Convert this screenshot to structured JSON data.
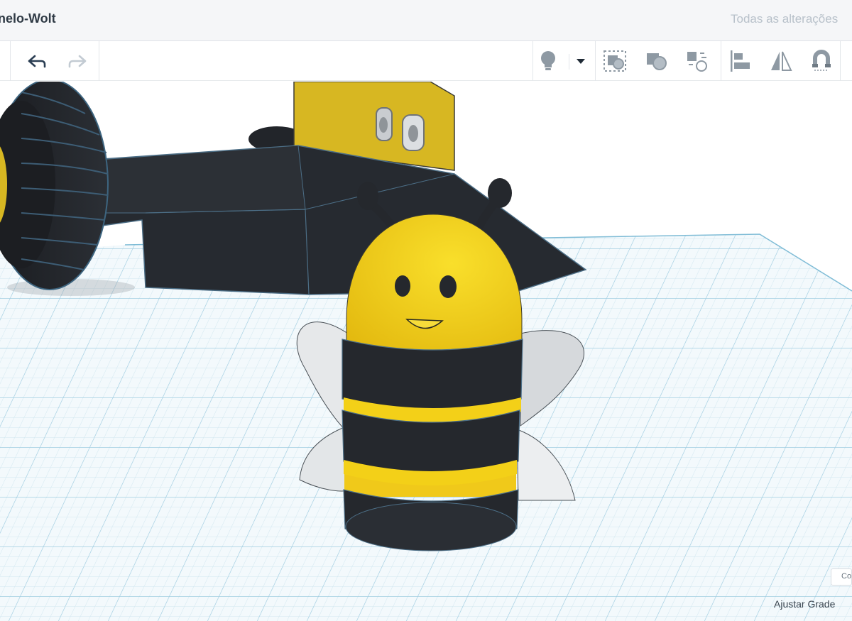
{
  "header": {
    "project_name": "nelo-Wolt",
    "save_status": "Todas as alterações"
  },
  "toolbar": {
    "left": [
      {
        "icon": "undo-icon"
      },
      {
        "icon": "redo-icon"
      }
    ],
    "right": [
      {
        "icon": "lightbulb-icon"
      },
      {
        "icon": "caret-down-icon"
      },
      {
        "icon": "group-icon"
      },
      {
        "icon": "ungroup-icon"
      },
      {
        "icon": "align-icon"
      },
      {
        "icon": "mirror-icon"
      },
      {
        "icon": "magnet-icon"
      }
    ]
  },
  "viewport": {
    "scene_objects": [
      "robot-car",
      "bee"
    ],
    "corner_chip_label": "Co",
    "fit_grid_label": "Ajustar Grade"
  },
  "colors": {
    "accent_yellow": "#f3d018",
    "body_dark": "#25282d",
    "grid_line": "#bcdde9",
    "toolbar_icon": "#8e99a3"
  }
}
